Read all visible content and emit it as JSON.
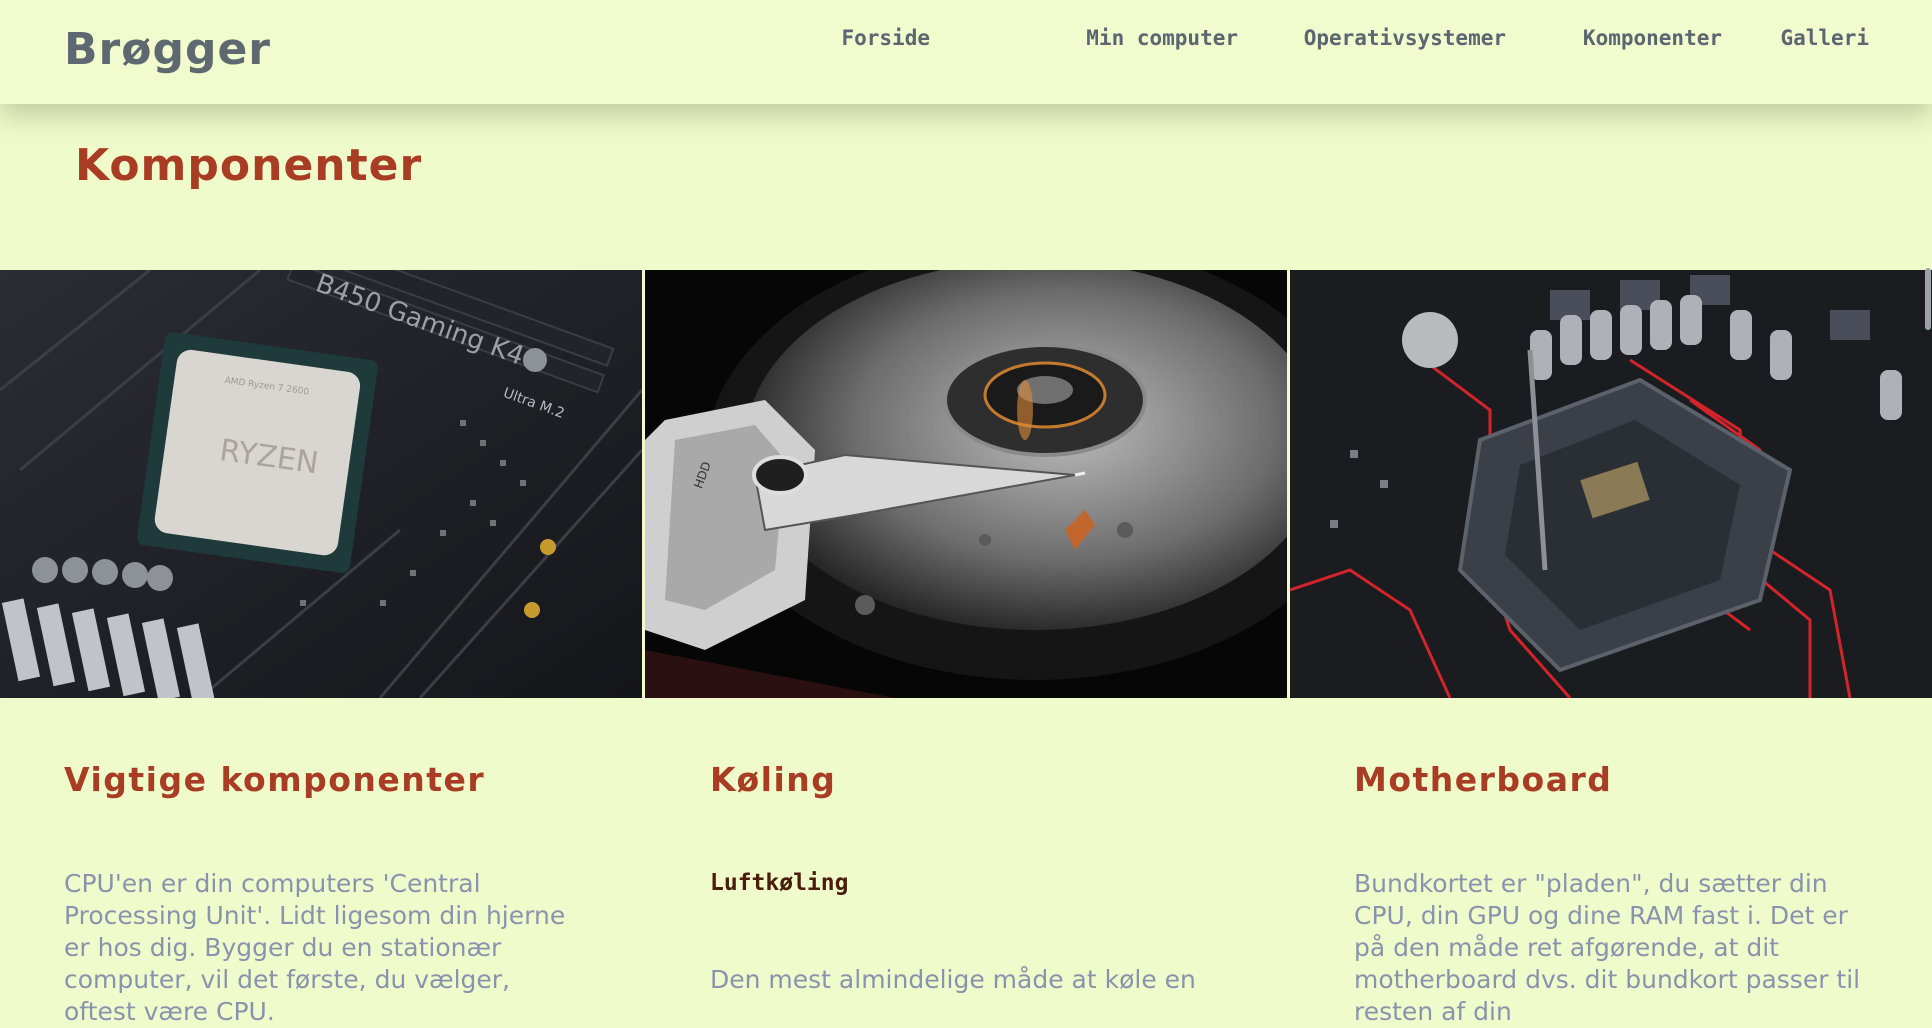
{
  "header": {
    "logo": "Brøgger",
    "nav": [
      {
        "label": "Forside"
      },
      {
        "label": "Min computer"
      },
      {
        "label": "Operativsystemer"
      },
      {
        "label": "Komponenter"
      },
      {
        "label": "Galleri"
      }
    ]
  },
  "main": {
    "title": "Komponenter",
    "images": {
      "cpu": {
        "chip_brand": "AMD Ryzen 7 2600",
        "chip_text": "RYZEN",
        "board_text": "B450 Gaming K4",
        "slot_text": "Ultra M.2"
      },
      "hdd": {
        "label_text": "HDD"
      },
      "motherboard": {}
    },
    "columns": [
      {
        "heading": "Vigtige komponenter",
        "body": "CPU'en er din computers 'Central Processing Unit'. Lidt ligesom din hjerne er hos dig. Bygger du en stationær computer, vil det første, du vælger, oftest være CPU."
      },
      {
        "heading": "Køling",
        "subheading": "Luftkøling",
        "body": "Den mest almindelige måde at køle en"
      },
      {
        "heading": "Motherboard",
        "body": "Bundkortet er \"pladen\", du sætter din CPU, din GPU og dine RAM fast i. Det er på den måde ret afgørende, at dit motherboard dvs. dit bundkort passer til resten af din"
      }
    ]
  },
  "colors": {
    "background": "#f0fbcb",
    "accent": "#a93d24",
    "nav_text": "#5b6670",
    "body_text": "#8a93ad"
  }
}
